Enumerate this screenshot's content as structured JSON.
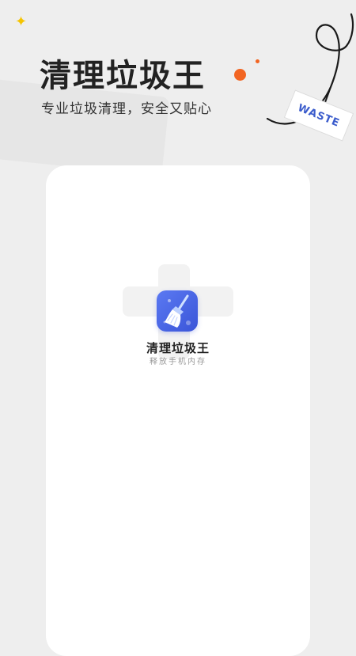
{
  "header": {
    "title": "清理垃圾王",
    "subtitle": "专业垃圾清理，安全又贴心"
  },
  "decor": {
    "tag_text": "WASTE",
    "sparkle_icon": "sparkle-icon",
    "accent_color": "#f26522",
    "sparkle_color": "#f5c400",
    "tag_text_color": "#3b5ccc"
  },
  "splash": {
    "app_name": "清理垃圾王",
    "tagline": "释放手机内存",
    "icon": "broom-icon",
    "icon_color": "#4a66e6"
  }
}
